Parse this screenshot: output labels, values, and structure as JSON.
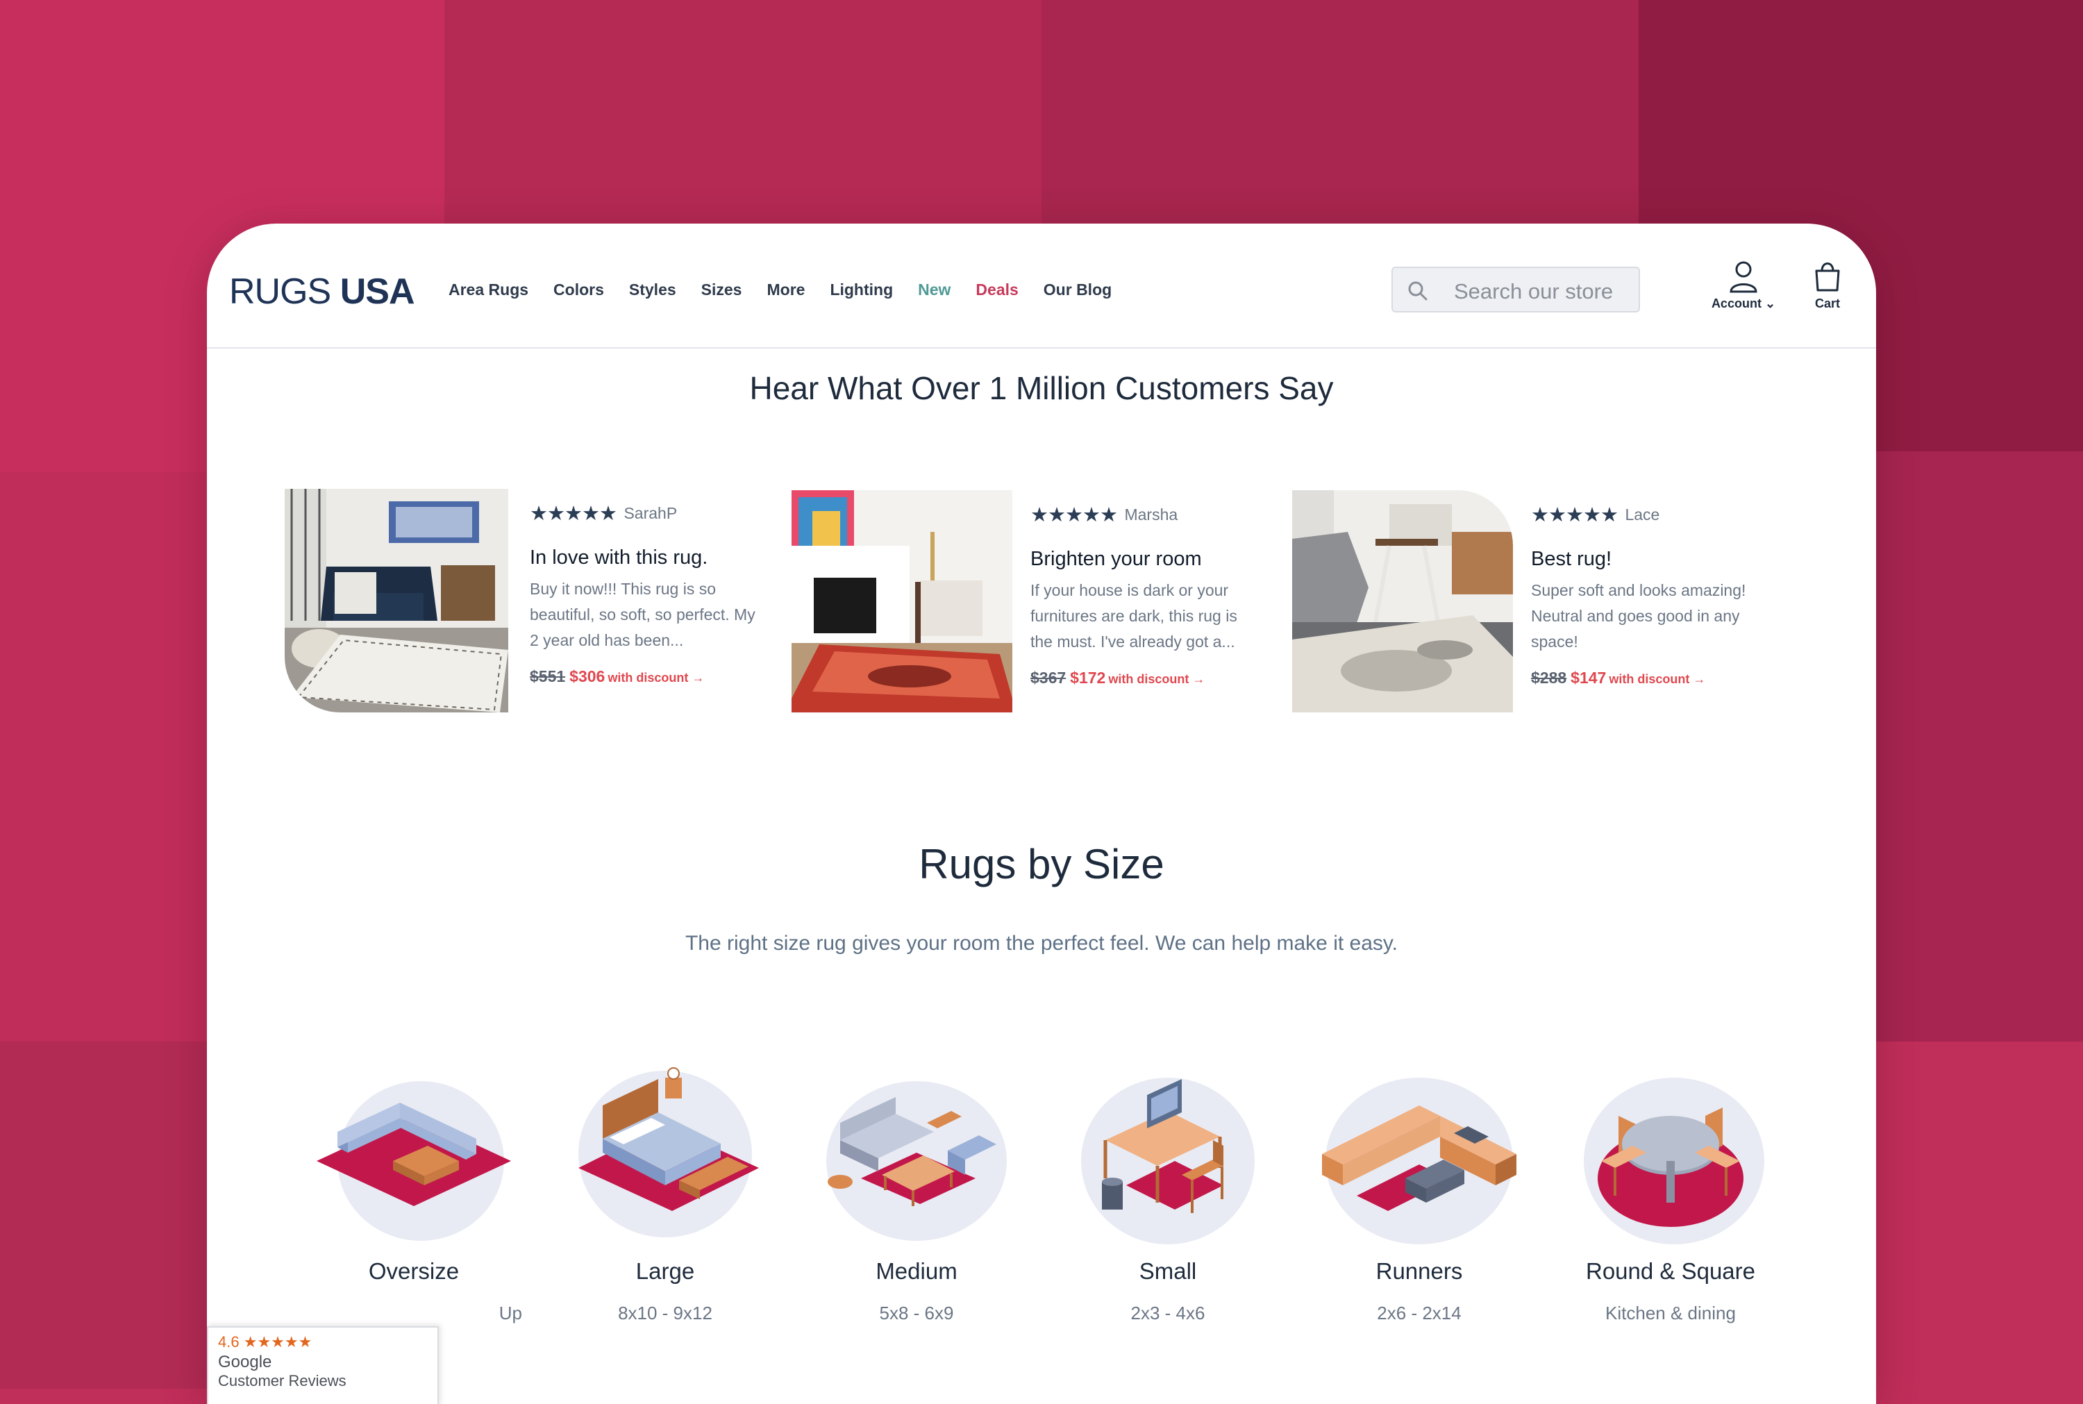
{
  "page": {
    "background": "#c02e5a"
  },
  "brand": {
    "logo_part1": "RUGS",
    "logo_part2": "USA",
    "color": "#1e3356"
  },
  "nav": {
    "items": [
      {
        "label": "Area Rugs"
      },
      {
        "label": "Colors"
      },
      {
        "label": "Styles"
      },
      {
        "label": "Sizes"
      },
      {
        "label": "More"
      },
      {
        "label": "Lighting"
      },
      {
        "label": "New",
        "color": "#4f9a96"
      },
      {
        "label": "Deals",
        "color": "#c73a5b"
      },
      {
        "label": "Our Blog"
      }
    ]
  },
  "search": {
    "placeholder": "Search our store",
    "icon": "search-icon"
  },
  "header_actions": {
    "account_label": "Account",
    "account_icon": "user-icon",
    "cart_label": "Cart",
    "cart_icon": "shopping-bag-icon"
  },
  "reviews": {
    "heading": "Hear What Over 1 Million Customers Say",
    "items": [
      {
        "stars": "★★★★★",
        "reviewer": "SarahP",
        "title": "In love with this rug.",
        "body": "Buy it now!!! This rug is so beautiful, so soft, so perfect. My 2 year old has been...",
        "old_price": "$551",
        "new_price": "$306",
        "discount_label": "with discount →"
      },
      {
        "stars": "★★★★★",
        "reviewer": "Marsha",
        "title": "Brighten your room",
        "body": "If your house is dark or your furnitures are dark, this rug is the must. I've already got a...",
        "old_price": "$367",
        "new_price": "$172",
        "discount_label": "with discount →"
      },
      {
        "stars": "★★★★★",
        "reviewer": "Lace",
        "title": "Best rug!",
        "body": "Super soft and looks amazing! Neutral and goes good in any space!",
        "old_price": "$288",
        "new_price": "$147",
        "discount_label": "with discount →"
      }
    ]
  },
  "sizes": {
    "heading": "Rugs by Size",
    "subheading": "The right size rug gives your room the perfect feel. We can help make it easy.",
    "items": [
      {
        "name": "Oversize",
        "dims": "Up",
        "icon": "oversize-room-illustration"
      },
      {
        "name": "Large",
        "dims": "8x10 - 9x12",
        "icon": "bedroom-illustration"
      },
      {
        "name": "Medium",
        "dims": "5x8 - 6x9",
        "icon": "living-room-illustration"
      },
      {
        "name": "Small",
        "dims": "2x3 - 4x6",
        "icon": "desk-illustration"
      },
      {
        "name": "Runners",
        "dims": "2x6 - 2x14",
        "icon": "kitchen-illustration"
      },
      {
        "name": "Round & Square",
        "dims": "Kitchen & dining",
        "icon": "dining-table-illustration"
      }
    ]
  },
  "google_badge": {
    "rating": "4.6",
    "stars": "★★★★★",
    "name": "Google",
    "subtitle": "Customer Reviews"
  },
  "colors": {
    "rug_accent": "#c2174a",
    "price_red": "#e0484f",
    "text_dark": "#1e2b3c"
  }
}
